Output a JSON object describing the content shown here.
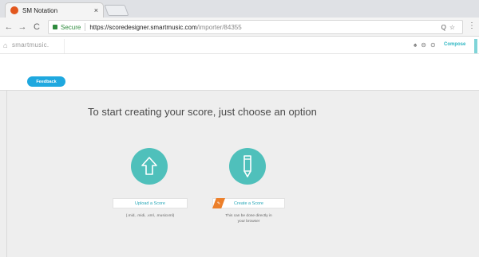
{
  "browser": {
    "tab_title": "SM Notation",
    "tab_close": "×",
    "url_secure_label": "Secure",
    "url_host": "https://scoredesigner.smartmusic.com",
    "url_path": "/importer/84355",
    "nav_back": "←",
    "nav_forward": "→",
    "nav_reload": "C",
    "omnibox_right_icons": "Q☆",
    "menu": "⋮"
  },
  "app_header": {
    "home_icon": "⌂",
    "brand": "smartmusic.",
    "icons": "♠⊖⊙",
    "compose_label": "Compose"
  },
  "feedback_label": "Feedback",
  "main": {
    "heading": "To start creating your score, just choose an option",
    "upload": {
      "button_label": "Upload a Score",
      "hint": "(.mid, .midi, .xml, .musicxml)"
    },
    "create": {
      "badge": "✎",
      "button_label": "Create a Score",
      "hint_line1": "This can be done directly in",
      "hint_line2": "your browser"
    }
  },
  "colors": {
    "accent_teal": "#4fc0bb",
    "feedback_blue": "#1fa8df",
    "create_orange": "#ec7f2a",
    "secure_green": "#2e8b3d"
  }
}
